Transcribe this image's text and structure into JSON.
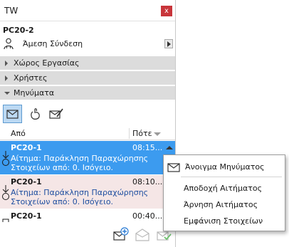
{
  "window": {
    "title": "TW",
    "close_label": "x"
  },
  "server_name": "PC20-2",
  "connection": {
    "label": "Άμεση Σύνδεση"
  },
  "sections": [
    {
      "title": "Χώρος Εργασίας",
      "expanded": false
    },
    {
      "title": "Χρήστες",
      "expanded": false
    },
    {
      "title": "Μηνύματα",
      "expanded": true
    }
  ],
  "toolbar": {
    "icons": [
      "inbox-icon",
      "compose-request-icon",
      "compose-message-icon"
    ]
  },
  "list": {
    "columns": {
      "from": "Από",
      "when": "Πότε"
    },
    "messages": [
      {
        "sender": "PC20-1",
        "time": "08:15...",
        "line2": "Αίτημα: Παράκληση Παραχώρησης",
        "line3": "Στοιχείων από: 0. Ισόγειο.",
        "state": "selected"
      },
      {
        "sender": "PC20-1",
        "time": "08:10...",
        "line2": "Αίτημα: Παράκληση Παραχώρησης",
        "line3": "Στοιχείων από: 0. Ισόγειο.",
        "state": "highlight"
      },
      {
        "sender": "PC20-1",
        "time": "00:40...",
        "line2": "",
        "line3": "",
        "state": "normal"
      }
    ]
  },
  "context_menu": {
    "items": [
      {
        "label": "Άνοιγμα Μηνύματος"
      },
      {
        "label": "Αποδοχή Αιτήματος"
      },
      {
        "label": "Άρνηση Αιτήματος"
      },
      {
        "label": "Εμφάνιση Στοιχείων"
      }
    ]
  },
  "colors": {
    "selected_row": "#3c9bef",
    "highlight_row": "#f5e6e6",
    "section_bg": "#dcdcdc",
    "close_button": "#c8353a"
  }
}
